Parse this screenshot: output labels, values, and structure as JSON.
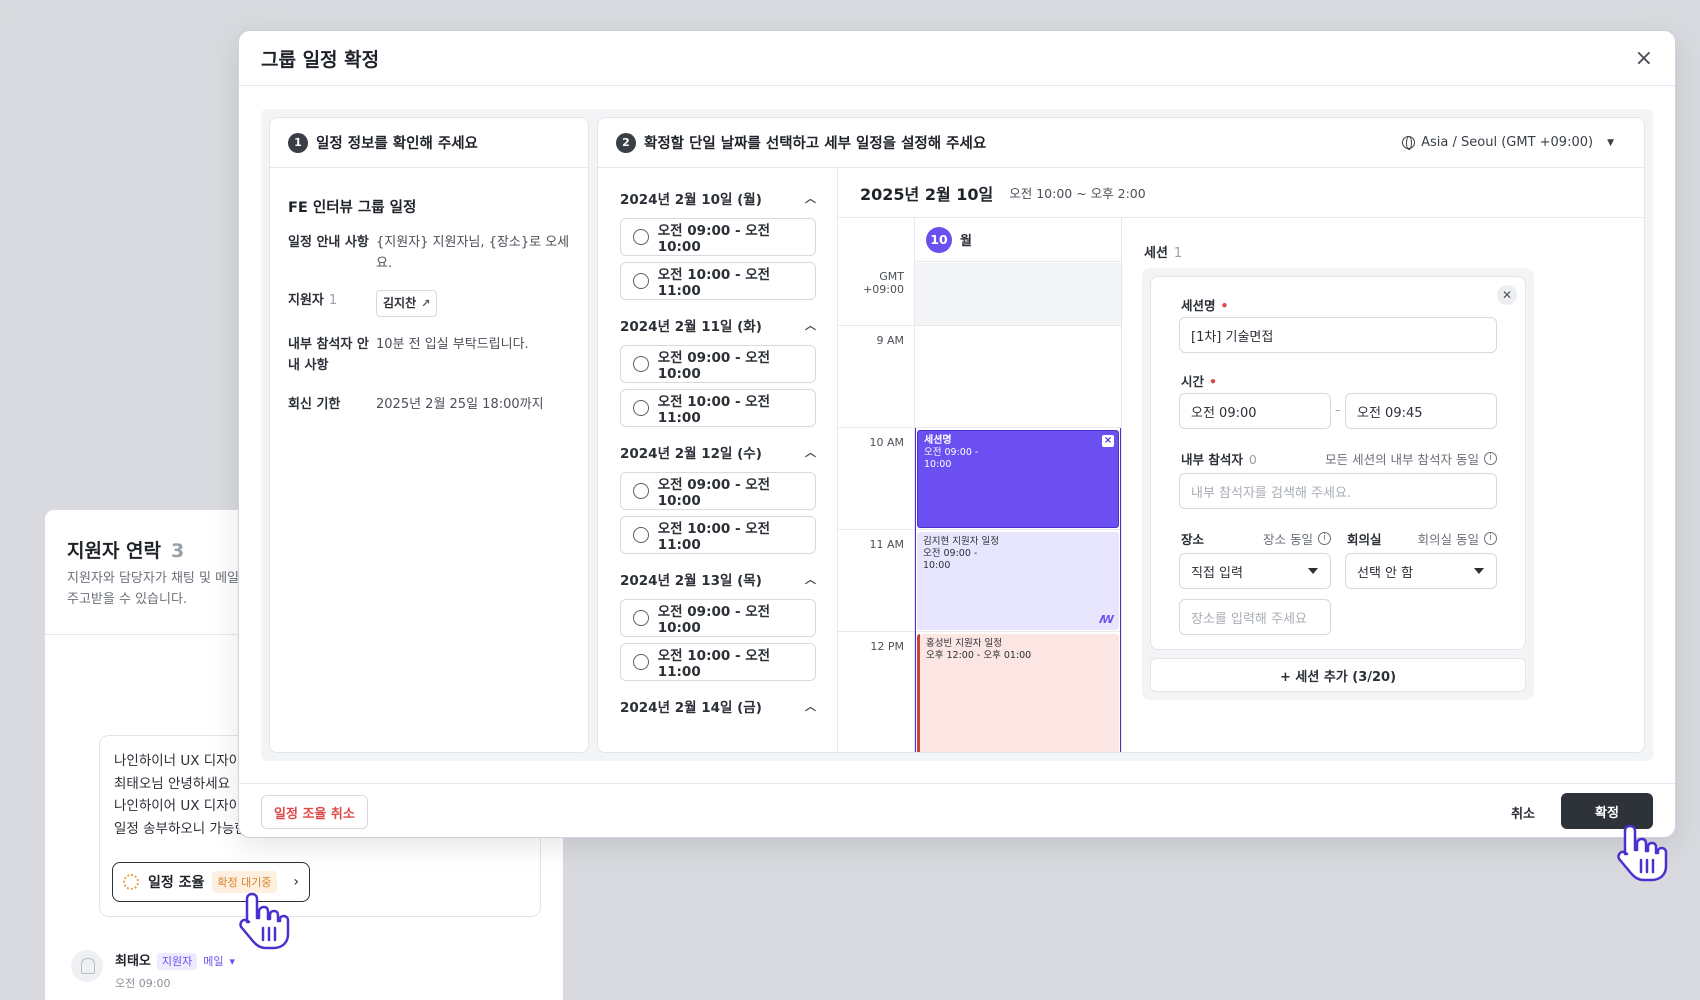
{
  "background_panel": {
    "title": "지원자 연락",
    "count": "3",
    "description": "지원자와 담당자가 채팅 및 메일을 주고받을 수 있습니다.",
    "message_lines": [
      "나인하이너 UX 디자이너입니다.",
      "최태오님 안녕하세요",
      "나인하이어 UX 디자이너 면접",
      "일정 송부하오니 가능한 일정을"
    ],
    "schedule_chip": {
      "label": "일정 조율",
      "badge": "확정 대기중",
      "arrow": "›"
    },
    "person": {
      "name": "최태오",
      "tag": "지원자",
      "channel": "메일",
      "time": "오전 09:00"
    }
  },
  "modal": {
    "title": "그룹 일정 확정",
    "close": "×",
    "step1": {
      "number": "1",
      "title": "일정 정보를 확인해 주세요",
      "event_name": "FE 인터뷰 그룹 일정",
      "rows": [
        {
          "label": "일정 안내 사항",
          "value": "{지원자} 지원자님, {장소}로 오세요."
        },
        {
          "label": "지원자",
          "count": "1",
          "chip": "김지찬"
        },
        {
          "label": "내부 참석자 안내 사항",
          "value": "10분 전 입실 부탁드립니다."
        },
        {
          "label": "회신 기한",
          "value": "2025년 2월 25일 18:00까지"
        }
      ]
    },
    "step2": {
      "number": "2",
      "title": "확정할 단일 날짜를 선택하고 세부 일정을 설정해 주세요",
      "timezone": "Asia / Seoul (GMT +09:00)",
      "dates": [
        {
          "label": "2024년 2월 10일 (월)",
          "slots": [
            "오전 09:00 - 오전 10:00",
            "오전 10:00 - 오전 11:00"
          ]
        },
        {
          "label": "2024년 2월 11일 (화)",
          "slots": [
            "오전 09:00 - 오전 10:00",
            "오전 10:00 - 오전 11:00"
          ]
        },
        {
          "label": "2024년 2월 12일 (수)",
          "slots": [
            "오전 09:00 - 오전 10:00",
            "오전 10:00 - 오전 11:00"
          ]
        },
        {
          "label": "2024년 2월 13일 (목)",
          "slots": [
            "오전 09:00 - 오전 10:00",
            "오전 10:00 - 오전 11:00"
          ]
        },
        {
          "label": "2024년 2월 14일 (금)",
          "slots": []
        }
      ],
      "calendar": {
        "date": "2025년 2월 10일",
        "range": "오전 10:00 ~ 오후 2:00",
        "day_number": "10",
        "day_name": "월",
        "gmt_line1": "GMT",
        "gmt_line2": "+09:00",
        "hours": [
          "9 AM",
          "10 AM",
          "11 AM",
          "12 PM"
        ],
        "events": [
          {
            "title": "세션명",
            "line1": "오전 09:00 -",
            "line2": "10:00",
            "color": "#6c4ff0"
          },
          {
            "title": "김지현 지원자 일정",
            "line1": "오전 09:00 -",
            "line2": "10:00",
            "color": "#e8e6ff",
            "mark": "ꟿ"
          },
          {
            "title": "홍성빈 지원자 일정",
            "line1": "오후 12:00 - 오후 01:00",
            "line2": "",
            "color": "#fbe6e3"
          }
        ]
      },
      "session": {
        "title": "세션",
        "count": "1",
        "name_label": "세션명",
        "name_value": "[1차] 기술면접",
        "time_label": "시간",
        "time_start": "오전 09:00",
        "time_end": "오전 09:45",
        "time_dash": "–",
        "attendee_label": "내부 참석자",
        "attendee_count": "0",
        "attendee_same": "모든 세션의 내부 참석자 동일",
        "attendee_placeholder": "내부 참석자를 검색해 주세요.",
        "place_label": "장소",
        "place_same": "장소 동일",
        "room_label": "회의실",
        "room_same": "회의실 동일",
        "place_select": "직접 입력",
        "room_select": "선택 안 함",
        "place_placeholder": "장소를 입력해 주세요",
        "add_button": "+ 세션 추가 (3/20)"
      }
    },
    "footer": {
      "cancel_schedule": "일정 조율 취소",
      "cancel": "취소",
      "confirm": "확정"
    }
  },
  "colors": {
    "accent": "#6c4ff0",
    "dark_button": "#2e3239",
    "danger": "#e04848"
  }
}
